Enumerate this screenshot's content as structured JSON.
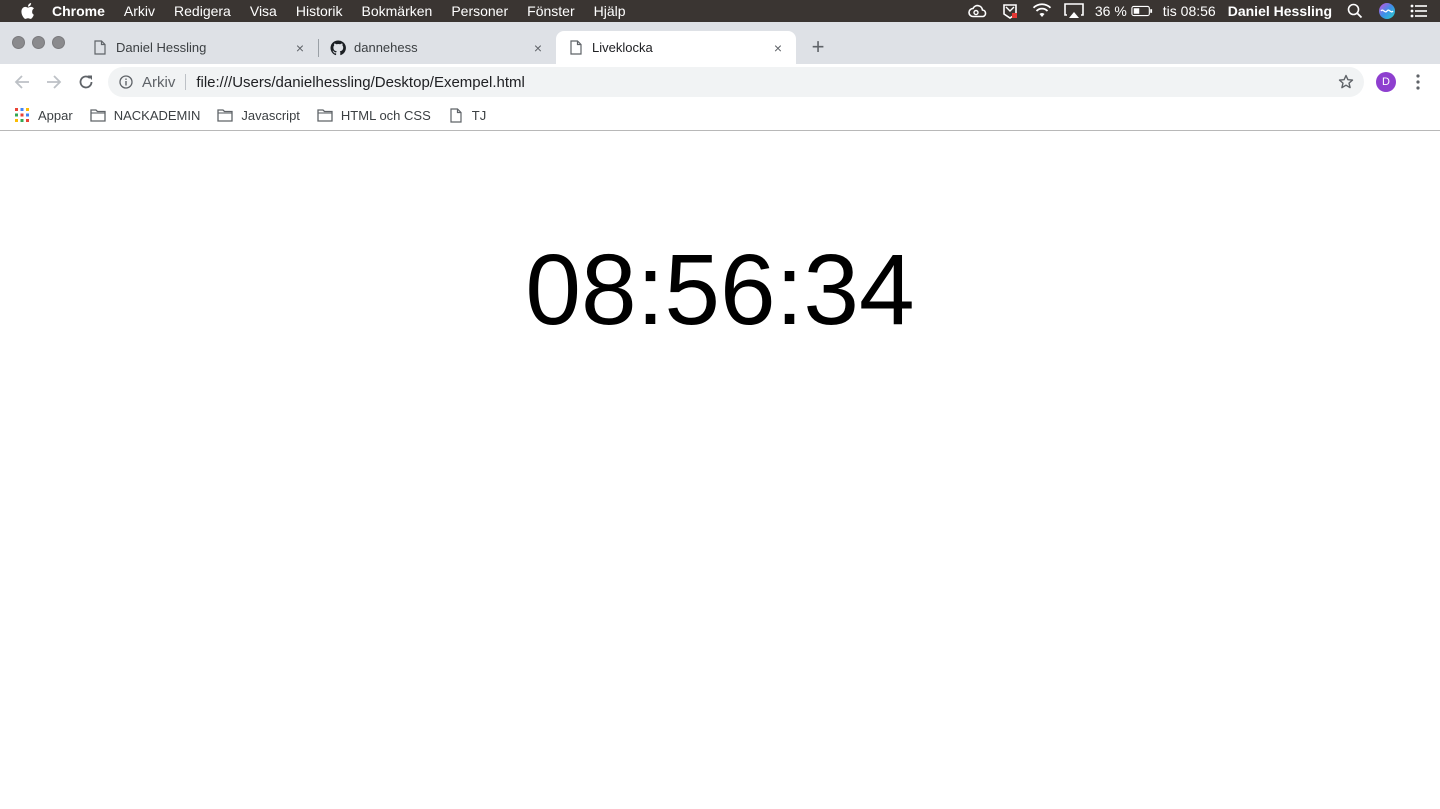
{
  "menubar": {
    "apple_icon": "apple-logo-icon",
    "items": [
      "Chrome",
      "Arkiv",
      "Redigera",
      "Visa",
      "Historik",
      "Bokmärken",
      "Personer",
      "Fönster",
      "Hjälp"
    ],
    "status": {
      "battery_percent": "36 %",
      "clock": "tis 08:56",
      "user": "Daniel Hessling"
    }
  },
  "tabs": [
    {
      "title": "Daniel Hessling",
      "icon": "page-icon",
      "close": "×"
    },
    {
      "title": "dannehess",
      "icon": "github-icon",
      "close": "×"
    },
    {
      "title": "Liveklocka",
      "icon": "page-icon",
      "close": "×",
      "active": true
    }
  ],
  "newtab_label": "+",
  "toolbar": {
    "scheme_label": "Arkiv",
    "url": "file:///Users/danielhessling/Desktop/Exempel.html",
    "avatar_letter": "D"
  },
  "bookmarks": [
    {
      "label": "Appar",
      "icon": "apps-grid-icon"
    },
    {
      "label": "NACKADEMIN",
      "icon": "folder-icon"
    },
    {
      "label": "Javascript",
      "icon": "folder-icon"
    },
    {
      "label": "HTML och CSS",
      "icon": "folder-icon"
    },
    {
      "label": "TJ",
      "icon": "page-icon"
    }
  ],
  "page": {
    "clock_text": "08:56:34"
  },
  "colors": {
    "menubar_bg": "#3a3532",
    "tabstrip_bg": "#dee1e6",
    "omnibox_bg": "#f1f3f4",
    "avatar_bg": "#8e3fcf"
  }
}
